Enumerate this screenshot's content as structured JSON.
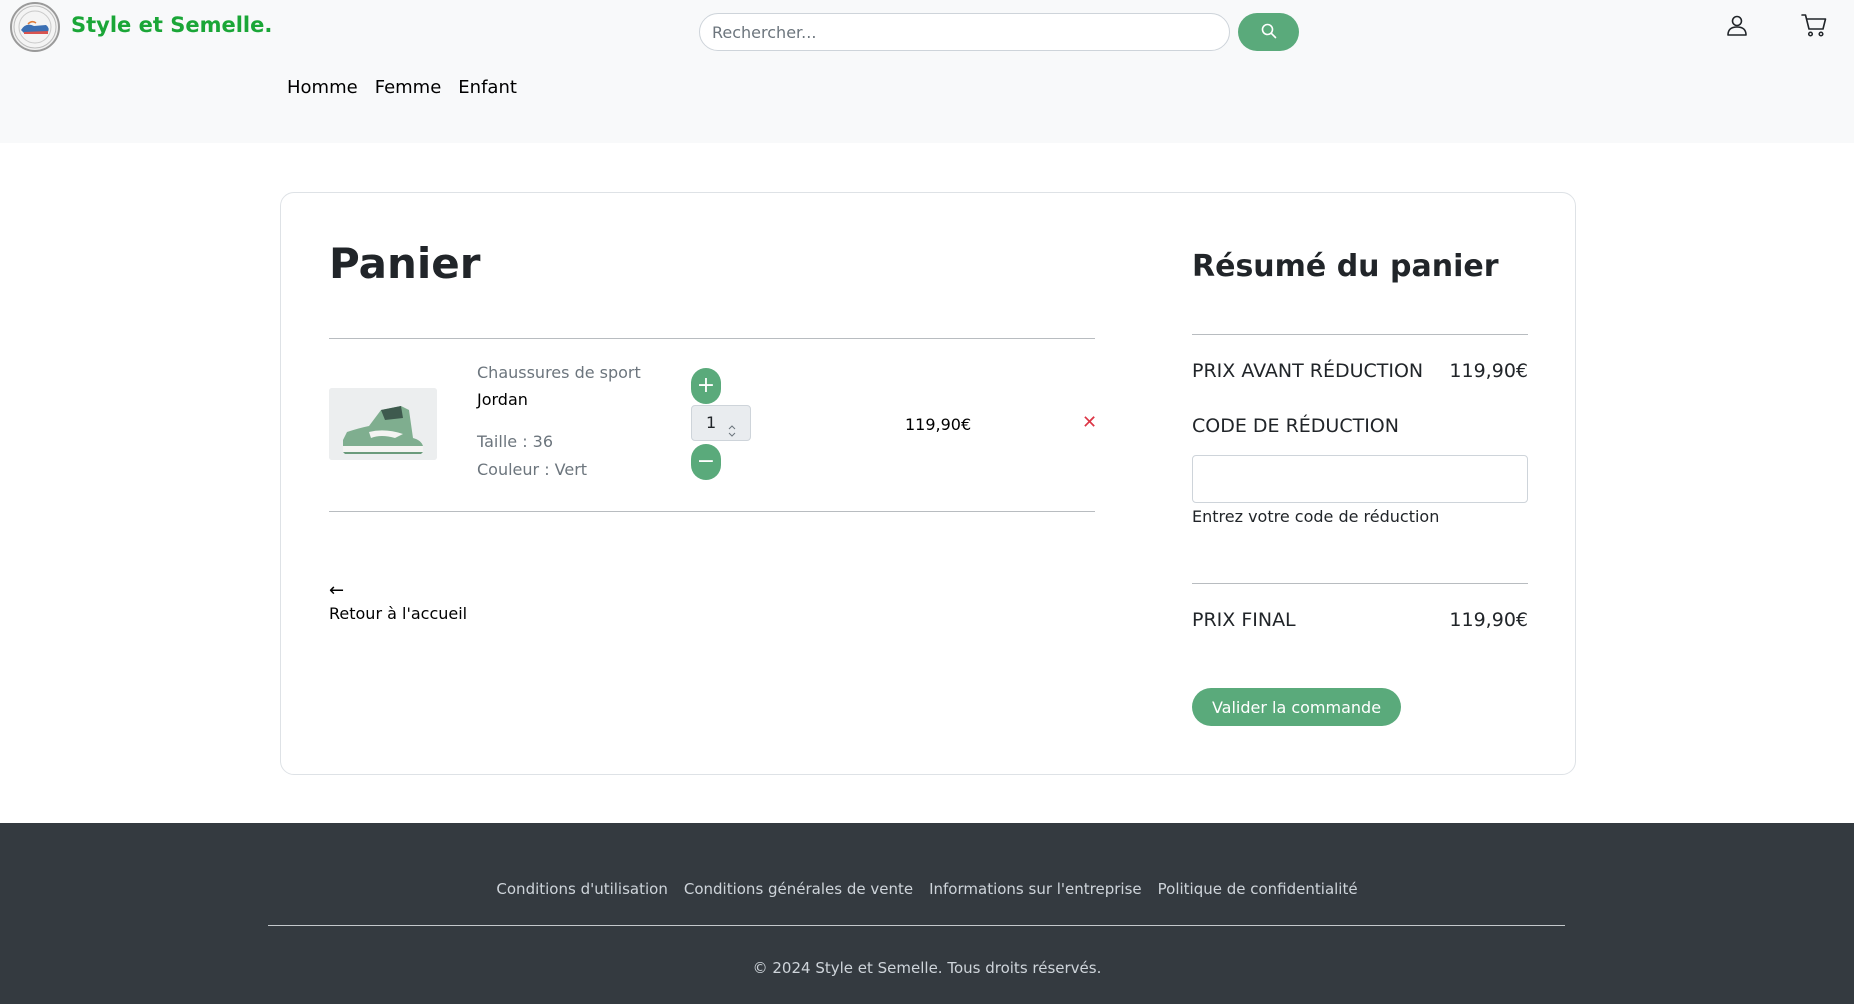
{
  "header": {
    "brand": "Style et Semelle.",
    "search": {
      "placeholder": "Rechercher...",
      "value": ""
    },
    "nav": [
      "Homme",
      "Femme",
      "Enfant"
    ]
  },
  "cart": {
    "title": "Panier",
    "item": {
      "category": "Chaussures de sport",
      "name": "Jordan",
      "size": "Taille : 36",
      "color": "Couleur : Vert",
      "quantity": "1",
      "plus": "+",
      "minus": "−",
      "price": "119,90€",
      "remove": "✕"
    },
    "back_arrow": "←",
    "back_label": "Retour à l'accueil"
  },
  "summary": {
    "title": "Résumé du panier",
    "before_label": "PRIX AVANT RÉDUCTION",
    "before_value": "119,90€",
    "code_label": "CODE DE RÉDUCTION",
    "code_value": "",
    "code_help": "Entrez votre code de réduction",
    "final_label": "PRIX FINAL",
    "final_value": "119,90€",
    "validate": "Valider la commande"
  },
  "footer": {
    "links": [
      "Conditions d'utilisation",
      "Conditions générales de vente",
      "Informations sur l'entreprise",
      "Politique de confidentialité"
    ],
    "copyright": "© 2024 Style et Semelle. Tous droits réservés."
  },
  "colors": {
    "accent": "#5aaa7b",
    "brand": "#1aa637",
    "danger": "#dc3545",
    "footer_bg": "#343a40"
  },
  "icons": {
    "search": "search-icon",
    "user": "user-icon",
    "cart": "cart-icon",
    "remove": "close-icon",
    "back": "arrow-left-icon"
  }
}
